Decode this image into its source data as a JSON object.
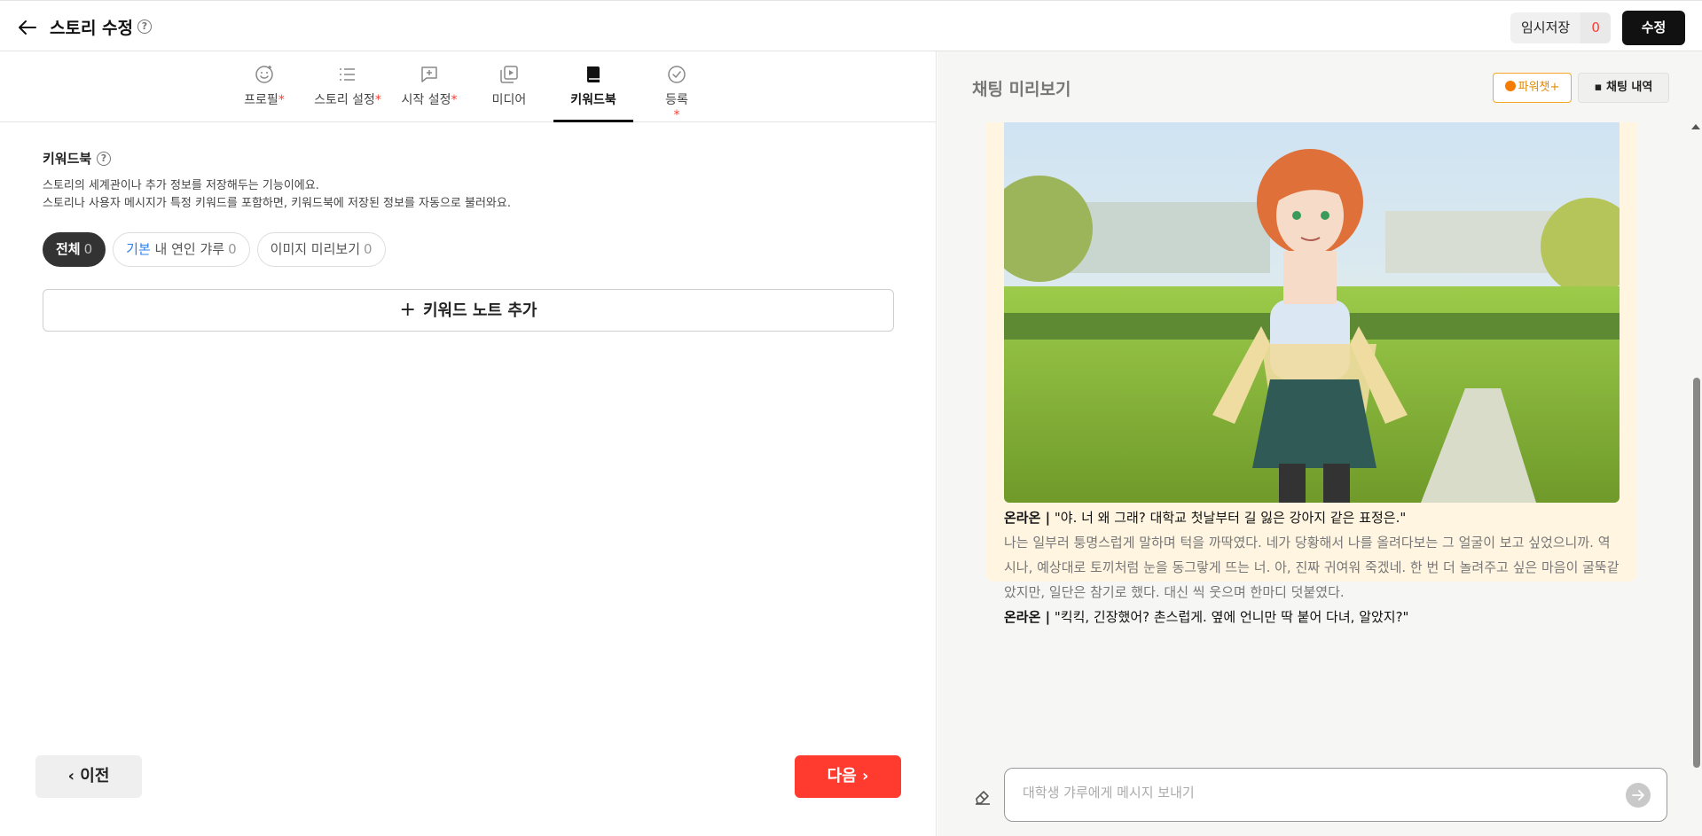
{
  "header": {
    "title": "스토리 수정",
    "help": "?",
    "temp_save_label": "임시저장",
    "temp_save_count": "0",
    "edit_label": "수정"
  },
  "tabs": [
    {
      "label": "프로필",
      "required": "*"
    },
    {
      "label": "스토리 설정",
      "required": "*"
    },
    {
      "label": "시작 설정",
      "required": "*"
    },
    {
      "label": "미디어",
      "required": ""
    },
    {
      "label": "키워드북",
      "required": ""
    },
    {
      "label": "등록",
      "required": "*"
    }
  ],
  "keywordbook": {
    "title": "키워드북",
    "desc1": "스토리의 세계관이나 추가 정보를 저장해두는 기능이에요.",
    "desc2": "스토리나 사용자 메시지가 특정 키워드를 포함하면, 키워드북에 저장된 정보를 자동으로 불러와요.",
    "filters": [
      {
        "prefix": "",
        "label": "전체",
        "count": "0"
      },
      {
        "prefix": "기본",
        "label": "내 연인 갸루",
        "count": "0"
      },
      {
        "prefix": "",
        "label": "이미지 미리보기",
        "count": "0"
      }
    ],
    "add_label": "키워드 노트 추가"
  },
  "nav": {
    "prev_label": "이전",
    "next_label": "다음"
  },
  "preview": {
    "title": "채팅 미리보기",
    "power_label": "파워챗+",
    "history_label": "채팅 내역",
    "messages": [
      {
        "speaker": "온라온 |",
        "text": " \"야. 너 왜 그래? 대학교 첫날부터 길 잃은 강아지 같은 표정은.\""
      },
      {
        "narration": "나는 일부러 퉁명스럽게 말하며 턱을 까딱였다. 네가 당황해서 나를 올려다보는 그 얼굴이 보고 싶었으니까. 역시나, 예상대로 토끼처럼 눈을 동그랗게 뜨는 너. 아, 진짜 귀여워 죽겠네. 한 번 더 놀려주고 싶은 마음이 굴뚝같았지만, 일단은 참기로 했다. 대신 씩 웃으며 한마디 덧붙였다."
      },
      {
        "speaker": "온라온 |",
        "text": " \"킥킥, 긴장했어? 촌스럽게. 옆에 언니만 딱 붙어 다녀, 알았지?\""
      }
    ],
    "input_placeholder": "대학생 갸루에게 메시지 보내기"
  },
  "colors": {
    "accent_red": "#ff3b30",
    "power_orange": "#f5a623",
    "card_bg": "#fff5e1",
    "link_blue": "#2f80ed"
  }
}
